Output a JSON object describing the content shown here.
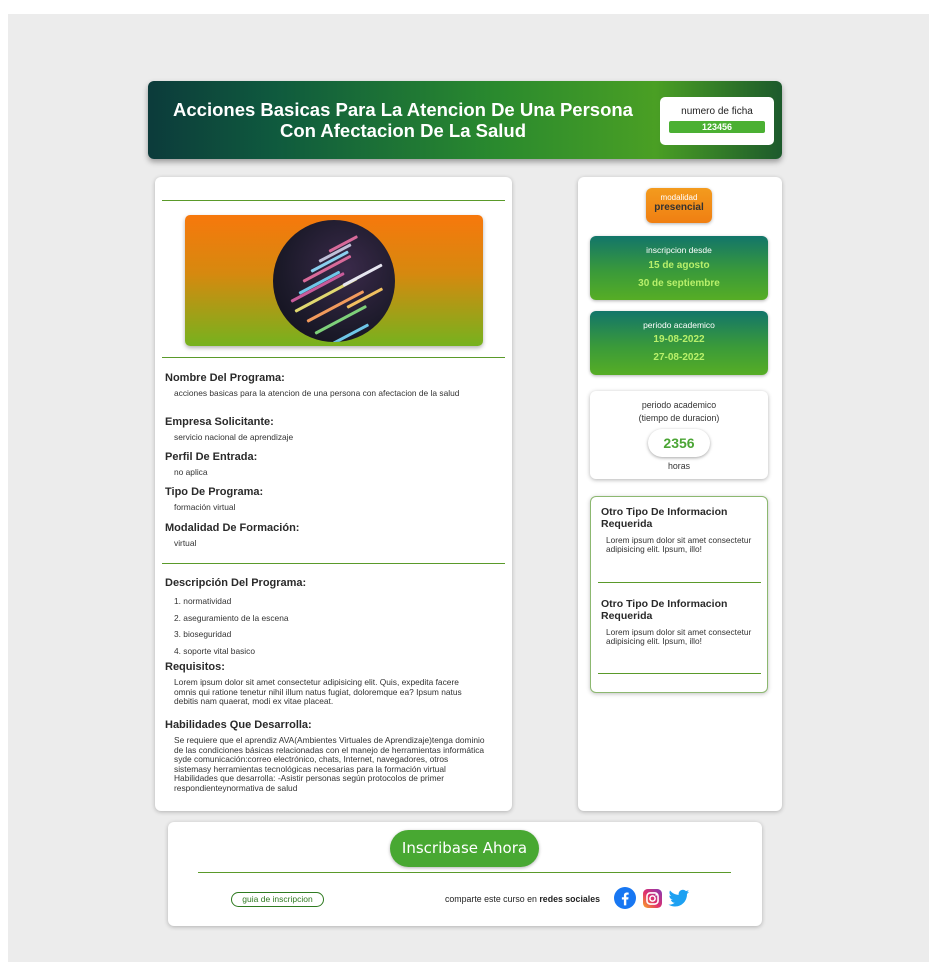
{
  "header": {
    "title": "Acciones Basicas Para La Atencion De Una Persona Con Afectacion De La Salud",
    "ficha_label": "numero de ficha",
    "ficha_value": "123456"
  },
  "program": {
    "sections": [
      {
        "title": "Nombre Del Programa:",
        "text": "acciones basicas para la atencion de una persona con afectacion de la salud"
      },
      {
        "title": "Empresa Solicitante:",
        "text": "servicio nacional de aprendizaje"
      },
      {
        "title": "Perfil De Entrada:",
        "text": "no aplica"
      },
      {
        "title": "Tipo De Programa:",
        "text": "formación virtual"
      },
      {
        "title": "Modalidad De Formación:",
        "text": "virtual"
      }
    ],
    "description_title": "Descripción Del Programa:",
    "description_items": [
      "1. normatividad",
      "2. aseguramiento de la escena",
      "3. bioseguridad",
      "4. soporte vital basico"
    ],
    "requirements_title": "Requisitos:",
    "requirements_text": "Lorem ipsum dolor sit amet consectetur adipisicing elit. Quis, expedita facere omnis qui ratione tenetur nihil illum natus fugiat, doloremque ea? Ipsum natus debitis nam quaerat, modi ex vitae placeat.",
    "skills_title": "Habilidades Que Desarrolla:",
    "skills_text": "Se requiere que el aprendiz AVA(Ambientes Virtuales de Aprendizaje)tenga dominio de las condiciones básicas relacionadas con el manejo de herramientas informática syde comunicación:correo electrónico, chats, Internet, navegadores, otros sistemasy herramientas tecnológicas necesarias para la formación virtual Habilidades que desarrolla: -Asistir personas según protocolos de primer respondienteynormativa de salud"
  },
  "sidebar": {
    "modalidad_label": "modalidad",
    "modalidad_value": "presencial",
    "inscripcion_label": "inscripcion desde",
    "inscripcion_from": "15 de agosto",
    "inscripcion_to": "30 de septiembre",
    "periodo_label": "periodo academico",
    "periodo_from": "19-08-2022",
    "periodo_to": "27-08-2022",
    "duracion_label": "periodo academico",
    "duracion_sub": "(tiempo de duracion)",
    "duracion_value": "2356",
    "duracion_unit": "horas",
    "info": [
      {
        "title": "Otro Tipo De Informacion Requerida",
        "text": "Lorem ipsum dolor sit amet consectetur adipisicing elit. Ipsum, illo!"
      },
      {
        "title": "Otro Tipo De Informacion Requerida",
        "text": "Lorem ipsum dolor sit amet consectetur adipisicing elit. Ipsum, illo!"
      }
    ]
  },
  "footer": {
    "cta_label": "Inscribase Ahora",
    "guide_link": "guia de inscripcion",
    "share_prefix": "comparte este curso en ",
    "share_bold": "redes sociales"
  },
  "colors": {
    "accent_green": "#48a832",
    "accent_orange": "#f07f12",
    "header_dark": "#0c3b3b",
    "facebook": "#1877f2",
    "twitter": "#1da1f2"
  },
  "icons": [
    "program-image",
    "facebook-icon",
    "instagram-icon",
    "twitter-icon"
  ]
}
